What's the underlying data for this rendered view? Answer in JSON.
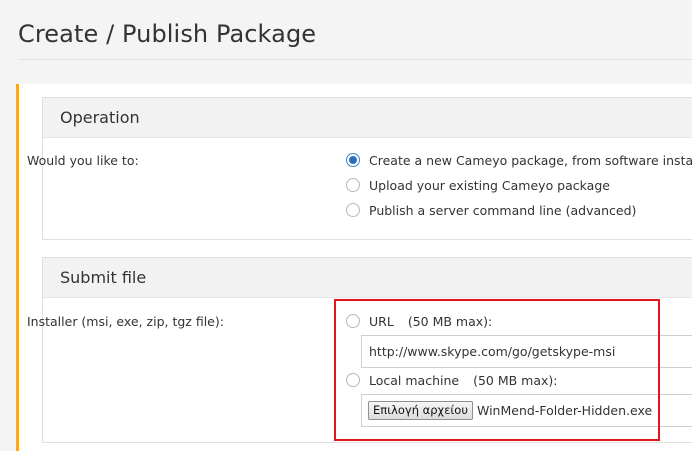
{
  "page": {
    "title": "Create / Publish Package"
  },
  "colors": {
    "accent_bar": "#f0a92e",
    "highlight": "#e2161c",
    "radio_selected": "#2a6fb8"
  },
  "operation": {
    "header": "Operation",
    "question": "Would you like to:",
    "options": [
      {
        "label": "Create a new Cameyo package, from software installer",
        "checked": true
      },
      {
        "label": "Upload your existing Cameyo package",
        "checked": false
      },
      {
        "label": "Publish a server command line (advanced)",
        "checked": false
      }
    ]
  },
  "submit": {
    "header": "Submit file",
    "installer_label": "Installer (msi, exe, zip, tgz file):",
    "url_option": {
      "label": "URL",
      "limit": "(50 MB max):",
      "checked": false
    },
    "url_value": "http://www.skype.com/go/getskype-msi",
    "local_option": {
      "label": "Local machine",
      "limit": "(50 MB max):",
      "checked": false
    },
    "file_button": "Επιλογή αρχείου",
    "file_name": "WinMend-Folder-Hidden.exe"
  }
}
